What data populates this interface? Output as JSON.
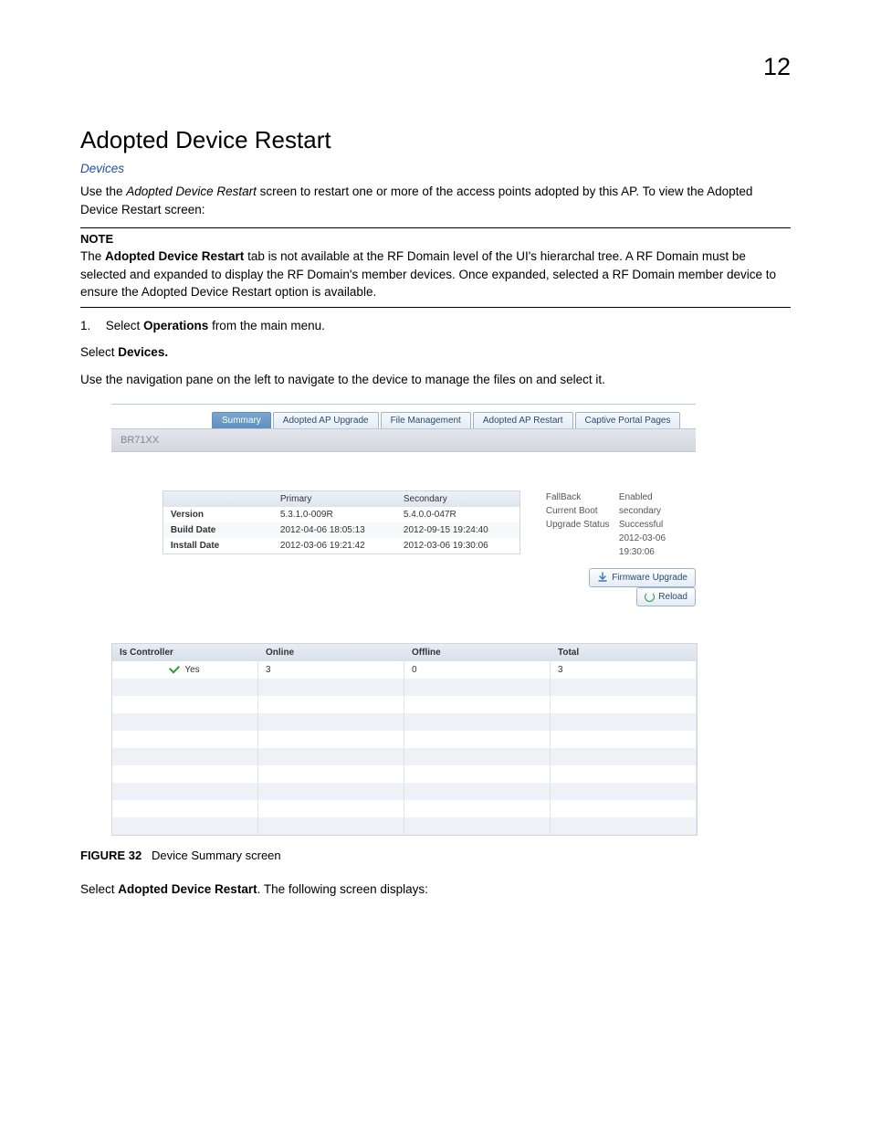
{
  "page_number": "12",
  "title": "Adopted Device Restart",
  "breadcrumb": "Devices",
  "intro_a": "Use the ",
  "intro_b": "Adopted Device Restart",
  "intro_c": " screen to restart one or more of the access points adopted by this AP. To view the Adopted Device Restart screen:",
  "note_label": "NOTE",
  "note_a": "The ",
  "note_b": "Adopted Device Restart",
  "note_c": " tab is not available at the RF Domain level of the UI's hierarchal tree. A RF Domain must be selected and expanded to display the RF Domain's member devices. Once expanded, selected a RF Domain member device to ensure the Adopted Device Restart option is available.",
  "step1_num": "1.",
  "step1_a": "Select ",
  "step1_b": "Operations",
  "step1_c": " from the main menu.",
  "step2_a": "Select ",
  "step2_b": "Devices.",
  "step3": "Use the navigation pane on the left to navigate to the device to manage the files on and select it.",
  "tabs": {
    "summary": "Summary",
    "upgrade": "Adopted AP Upgrade",
    "filemgmt": "File Management",
    "restart": "Adopted AP Restart",
    "captive": "Captive Portal Pages"
  },
  "device_band": "BR71XX",
  "vtable": {
    "h_primary": "Primary",
    "h_secondary": "Secondary",
    "r_version": "Version",
    "r_build": "Build Date",
    "r_install": "Install Date",
    "p_version": "5.3.1.0-009R",
    "s_version": "5.4.0.0-047R",
    "p_build": "2012-04-06 18:05:13",
    "s_build": "2012-09-15 19:24:40",
    "p_install": "2012-03-06 19:21:42",
    "s_install": "2012-03-06 19:30:06"
  },
  "status": {
    "fallback_k": "FallBack",
    "fallback_v": "Enabled",
    "curboot_k": "Current Boot",
    "curboot_v": "secondary",
    "upstat_k": "Upgrade Status",
    "upstat_v": "Successful",
    "upstat_ts": "2012-03-06 19:30:06"
  },
  "buttons": {
    "firmware": "Firmware Upgrade",
    "reload": "Reload"
  },
  "grid": {
    "h_is": "Is Controller",
    "h_on": "Online",
    "h_off": "Offline",
    "h_tot": "Total",
    "yes": "Yes",
    "on": "3",
    "off": "0",
    "tot": "3"
  },
  "figcap_label": "FIGURE 32",
  "figcap_text": "Device Summary screen",
  "final_a": "Select ",
  "final_b": "Adopted Device Restart",
  "final_c": ". The following screen displays:",
  "chart_data": {
    "type": "table",
    "title": "Device Summary screen",
    "version_table": {
      "columns": [
        "",
        "Primary",
        "Secondary"
      ],
      "rows": [
        [
          "Version",
          "5.3.1.0-009R",
          "5.4.0.0-047R"
        ],
        [
          "Build Date",
          "2012-04-06 18:05:13",
          "2012-09-15 19:24:40"
        ],
        [
          "Install Date",
          "2012-03-06 19:21:42",
          "2012-03-06 19:30:06"
        ]
      ]
    },
    "status_table": {
      "columns": [
        "Is Controller",
        "Online",
        "Offline",
        "Total"
      ],
      "rows": [
        [
          "Yes",
          3,
          0,
          3
        ]
      ]
    }
  }
}
